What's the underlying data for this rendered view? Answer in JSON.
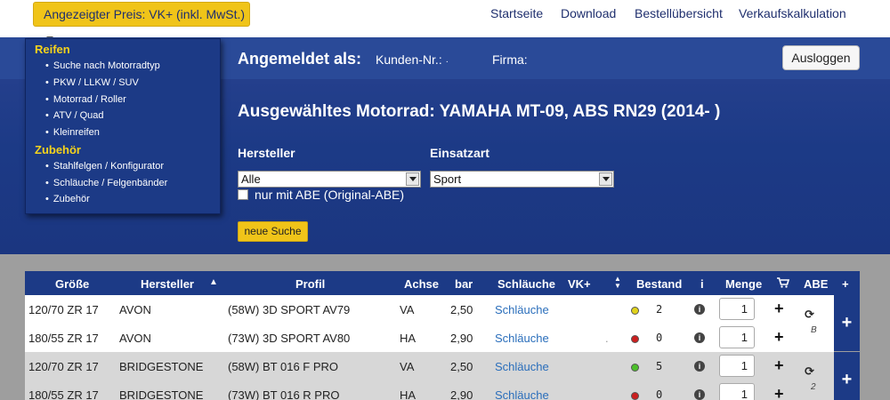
{
  "price_selector": {
    "label": "Angezeigter Preis: VK+ (inkl. MwSt.)"
  },
  "nav": {
    "items": [
      "Startseite",
      "Download",
      "Bestellübersicht",
      "Verkaufskalkulation"
    ]
  },
  "header": {
    "logged_in_label": "Angemeldet als:",
    "customer_label": "Kunden-Nr.:",
    "customer_value": "·",
    "company_label": "Firma:",
    "logout_label": "Ausloggen"
  },
  "menu": {
    "reifen_title": "Reifen",
    "reifen_items": [
      "Suche nach Motorradtyp",
      "PKW / LLKW / SUV",
      "Motorrad / Roller",
      "ATV / Quad",
      "Kleinreifen"
    ],
    "zubehoer_title": "Zubehör",
    "zubehoer_items": [
      "Stahlfelgen / Konfigurator",
      "Schläuche / Felgenbänder",
      "Zubehör"
    ]
  },
  "search": {
    "title": "Ausgewähltes Motorrad: YAMAHA MT-09, ABS RN29 (2014- )",
    "manufacturer_label": "Hersteller",
    "manufacturer_value": "Alle",
    "usage_label": "Einsatzart",
    "usage_value": "Sport",
    "abe_checkbox_label": "nur mit ABE (Original-ABE)",
    "abe_checked": false,
    "new_search_label": "neue Suche"
  },
  "table": {
    "columns": [
      "Größe",
      "Hersteller",
      "Profil",
      "Achse",
      "bar",
      "Schläuche",
      "VK+",
      "Bestand",
      "i",
      "Menge",
      "ABE",
      "+"
    ],
    "rows": [
      {
        "size": "120/70 ZR 17",
        "maker": "AVON",
        "profile": "(58W) 3D SPORT AV79",
        "axle": "VA",
        "bar": "2,50",
        "tubes": "Schläuche",
        "vk": "",
        "stock_color": "#e0d21c",
        "stock": "2",
        "qty": "1"
      },
      {
        "size": "180/55 ZR 17",
        "maker": "AVON",
        "profile": "(73W) 3D SPORT AV80",
        "axle": "HA",
        "bar": "2,90",
        "tubes": "Schläuche",
        "vk": ".",
        "stock_color": "#cc1f1f",
        "stock": "0",
        "qty": "1"
      },
      {
        "size": "120/70 ZR 17",
        "maker": "BRIDGESTONE",
        "profile": "(58W) BT 016 F PRO",
        "axle": "VA",
        "bar": "2,50",
        "tubes": "Schläuche",
        "vk": "",
        "stock_color": "#4cbf2a",
        "stock": "5",
        "qty": "1"
      },
      {
        "size": "180/55 ZR 17",
        "maker": "BRIDGESTONE",
        "profile": "(73W) BT 016 R PRO",
        "axle": "HA",
        "bar": "2,90",
        "tubes": "Schläuche",
        "vk": "",
        "stock_color": "#cc1f1f",
        "stock": "0",
        "qty": "1"
      }
    ],
    "abe_groups": [
      "B",
      "2"
    ]
  }
}
